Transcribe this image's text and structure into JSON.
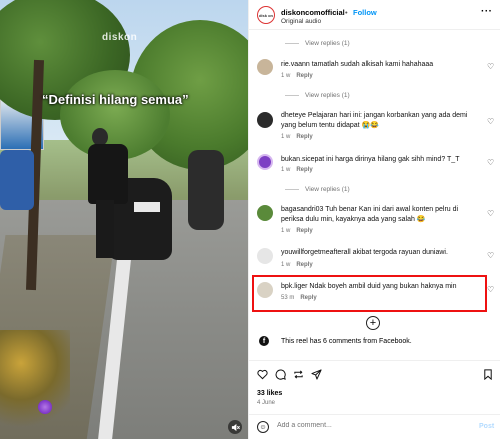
{
  "video": {
    "watermark": "diskon",
    "caption": "“Definisi hilang semua”",
    "mute_icon": "speaker-muted-icon"
  },
  "header": {
    "account": "diskoncomofficial",
    "separator": "•",
    "follow_label": "Follow",
    "audio": "Original audio",
    "avatar_text": "disk on",
    "more_icon": "more-horizontal-icon"
  },
  "view_replies": {
    "label_1": "View replies (1)",
    "label_2": "View replies (1)",
    "label_3": "View replies (1)"
  },
  "comments": [
    {
      "text": "rie.vaann tamatlah sudah alkisah kami hahahaaa",
      "time": "1 w",
      "reply": "Reply",
      "avatar_color": "#c8b59a"
    },
    {
      "text": "dheteye Pelajaran hari ini: jangan korbankan yang ada demi yang belum tentu didapat 😭😂",
      "time": "1 w",
      "reply": "Reply",
      "avatar_color": "#2b2b2b"
    },
    {
      "text": "bukan.sicepat ini harga dirinya hilang gak sihh mind? T_T",
      "time": "1 w",
      "reply": "Reply",
      "avatar_color": "#7d3fc4"
    },
    {
      "text": "bagasandri03 Tuh benar Kan ini dari awal konten pelru di periksa dulu min, kayaknya ada yang salah 😂",
      "time": "1 w",
      "reply": "Reply",
      "avatar_color": "#5a8a3a"
    },
    {
      "text": "youwillforgetmeafterall akibat tergoda rayuan duniawi.",
      "time": "1 w",
      "reply": "Reply",
      "avatar_color": "#e6e6e6"
    },
    {
      "text": "bpk.liger Ndak boyeh ambil duid yang bukan haknya min",
      "time": "53 m",
      "reply": "Reply",
      "avatar_color": "#d9d2c4"
    }
  ],
  "facebook": {
    "text": "This reel has 6 comments from Facebook.",
    "icon": "facebook-icon"
  },
  "actions": {
    "like_icon": "heart-icon",
    "comment_icon": "comment-icon",
    "share_icon": "share-icon",
    "save_icon": "bookmark-icon",
    "likes": "33 likes",
    "date": "4 June"
  },
  "composer": {
    "placeholder": "Add a comment...",
    "post_label": "Post",
    "emoji_icon": "emoji-icon"
  },
  "colors": {
    "accent": "#0095f6",
    "highlight": "#e11111"
  }
}
